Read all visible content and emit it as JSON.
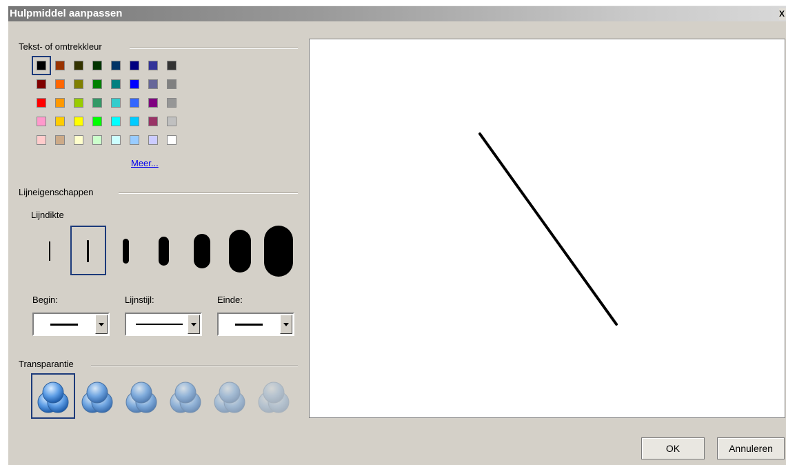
{
  "window": {
    "title": "Hulpmiddel aanpassen",
    "close_glyph": "X"
  },
  "color_section": {
    "label": "Tekst- of omtrekkleur",
    "more_link": "Meer...",
    "selected_index": 0,
    "rows": [
      [
        "#000000",
        "#993300",
        "#333300",
        "#003300",
        "#003366",
        "#000080",
        "#333399",
        "#333333"
      ],
      [
        "#800000",
        "#ff6600",
        "#808000",
        "#008000",
        "#008080",
        "#0000ff",
        "#666699",
        "#808080"
      ],
      [
        "#ff0000",
        "#ff9900",
        "#99cc00",
        "#339966",
        "#33cccc",
        "#3366ff",
        "#800080",
        "#969696"
      ],
      [
        "#ff99cc",
        "#ffcc00",
        "#ffff00",
        "#00ff00",
        "#00ffff",
        "#00ccff",
        "#993366",
        "#c0c0c0"
      ],
      [
        "#ffcccc",
        "#ccaa88",
        "#ffffcc",
        "#ccffcc",
        "#ccffff",
        "#99ccff",
        "#ccccff",
        "#ffffff"
      ]
    ]
  },
  "line_section": {
    "label": "Lijneigenschappen",
    "thickness_label": "Lijndikte",
    "selected_thickness": 1,
    "begin_label": "Begin:",
    "style_label": "Lijnstijl:",
    "end_label": "Einde:"
  },
  "transparency_section": {
    "label": "Transparantie",
    "selected_index": 0,
    "levels": [
      1.0,
      0.85,
      0.7,
      0.55,
      0.4,
      0.25
    ]
  },
  "buttons": {
    "ok": "OK",
    "cancel": "Annuleren"
  }
}
